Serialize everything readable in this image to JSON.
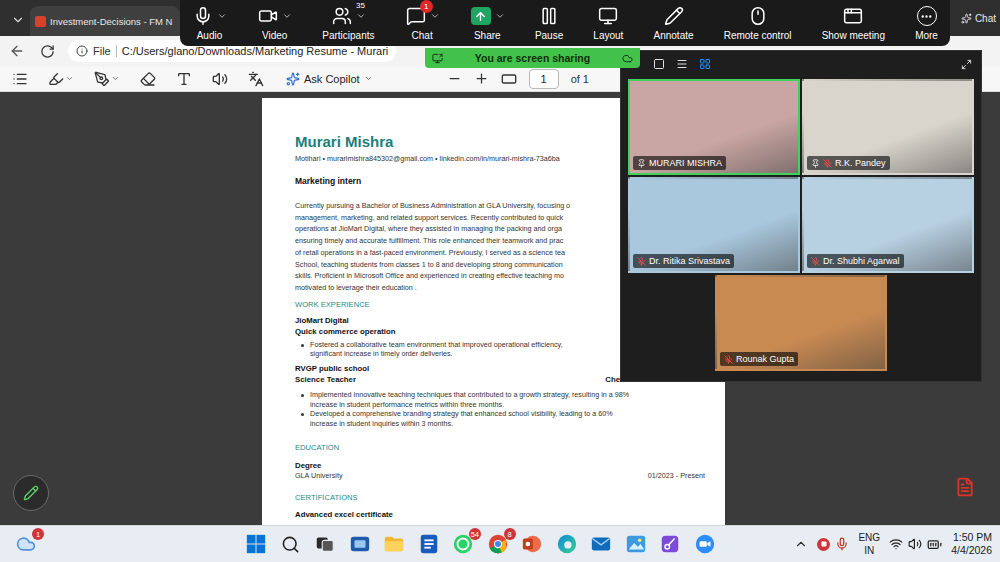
{
  "browser": {
    "tab_title": "Investment-Decisions - FM N",
    "address_scheme": "File",
    "address_path": "C:/Users/glano/Downloads/Marketing Resume - Murari",
    "chat_label": "Chat"
  },
  "meeting_toolbar": {
    "items": [
      {
        "kind": "audio",
        "label": "Audio",
        "caret": true
      },
      {
        "kind": "video",
        "label": "Video",
        "caret": true
      },
      {
        "kind": "participants",
        "label": "Participants",
        "caret": true,
        "count": "35"
      },
      {
        "kind": "chat",
        "label": "Chat",
        "caret": true,
        "badge": "1"
      },
      {
        "kind": "share",
        "label": "Share",
        "caret": true
      },
      {
        "kind": "pause",
        "label": "Pause",
        "caret": false
      },
      {
        "kind": "layout",
        "label": "Layout",
        "caret": false
      },
      {
        "kind": "annotate",
        "label": "Annotate",
        "caret": false
      },
      {
        "kind": "remote",
        "label": "Remote control",
        "caret": false
      },
      {
        "kind": "show_meeting",
        "label": "Show meeting",
        "caret": false
      },
      {
        "kind": "more",
        "label": "More",
        "caret": false
      }
    ]
  },
  "share_banner": {
    "text": "You are screen sharing"
  },
  "pdf_toolbar": {
    "copilot_label": "Ask Copilot",
    "page": "1",
    "page_total": "of 1"
  },
  "resume": {
    "name": "Murari Mishra",
    "contact": "Motihari • murarimishra845302@gmail.com • linkedin.com/in/murari-mishra-73a6ba",
    "title": "Marketing intern",
    "summary": [
      "Currently pursuing a Bachelor of Business Administration at GLA University, focusing o",
      "management, marketing, and related support services. Recently contributed to quick",
      "operations at JioMart Digital, where they assisted in managing the packing and orga",
      "ensuring timely and accurate fulfillment. This role enhanced their teamwork and prac",
      "of retail operations in a fast-paced environment. Previously, I served as a science tea",
      "School, teaching students from classes 1 to 8 and developing strong communication",
      "skills. Proficient in Microsoft Office and experienced in creating effective teaching mo",
      "motivated to leverage their education ."
    ],
    "work_heading": "WORK EXPERIENCE",
    "experience": [
      {
        "company": "JioMart Digital",
        "role": "Quick commerce operation",
        "bullets": [
          [
            "Fostered a collaborative team environment that improved operational efficiency,",
            "significant increase in timely order deliveries."
          ]
        ]
      },
      {
        "company": "RVGP public school",
        "role": "Science Teacher",
        "location": "Che",
        "bullets": [
          [
            "Implemented innovative teaching techniques that contributed to a growth strategy, resulting in a 98%",
            "increase in student performance metrics within three months."
          ],
          [
            "Developed a comprehensive branding strategy that enhanced school visibility, leading to a 60%",
            "increase in student inquiries within 3 months."
          ]
        ]
      }
    ],
    "education_heading": "EDUCATION",
    "education": [
      {
        "degree": "Degree",
        "school": "GLA University",
        "dates": "01/2023 - Present"
      }
    ],
    "certifications_heading": "CERTIFICATIONS",
    "certifications": [
      "Advanced excel certificate"
    ]
  },
  "gallery": {
    "views": [
      {
        "kind": "minimize",
        "selected": false
      },
      {
        "kind": "speaker",
        "selected": false
      },
      {
        "kind": "strip",
        "selected": false
      },
      {
        "kind": "grid",
        "selected": true
      }
    ],
    "participants": [
      {
        "name": "MURARI MISHRA",
        "pinned": true,
        "muted": false,
        "selected": true,
        "color": "#c9a6a3"
      },
      {
        "name": "R.K. Pandey",
        "pinned": true,
        "muted": true,
        "selected": false,
        "color": "#d9d5cc"
      },
      {
        "name": "Dr. Ritika Srivastava",
        "pinned": false,
        "muted": true,
        "selected": false,
        "color": "#a9c8de"
      },
      {
        "name": "Dr. Shubhi Agarwal",
        "pinned": false,
        "muted": true,
        "selected": false,
        "color": "#b7d0e2"
      },
      {
        "name": "Rounak Gupta",
        "pinned": false,
        "muted": true,
        "selected": false,
        "color": "#c98a52"
      }
    ]
  },
  "taskbar": {
    "weather_badge": "1",
    "apps": [
      {
        "kind": "start"
      },
      {
        "kind": "search"
      },
      {
        "kind": "taskview"
      },
      {
        "kind": "widgets"
      },
      {
        "kind": "explorer"
      },
      {
        "kind": "word"
      },
      {
        "kind": "whatsapp",
        "badge": "54"
      },
      {
        "kind": "chrome",
        "badge": "8"
      },
      {
        "kind": "powerpoint"
      },
      {
        "kind": "edge"
      },
      {
        "kind": "mail"
      },
      {
        "kind": "photos"
      },
      {
        "kind": "snip"
      },
      {
        "kind": "zoom"
      }
    ],
    "language": "ENG",
    "region": "IN",
    "time": "1:50 PM",
    "date": "4/4/2026"
  }
}
